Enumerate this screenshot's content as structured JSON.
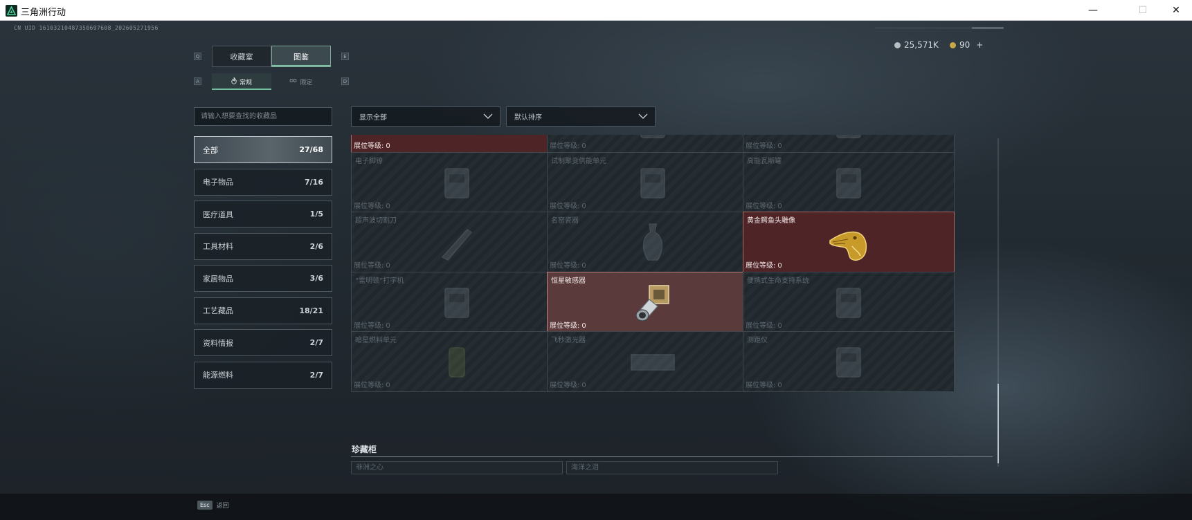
{
  "window": {
    "title": "三角洲行动",
    "minimize": "—",
    "maximize": "☐",
    "close": "✕"
  },
  "header": {
    "uid": "CN UID 16103210487350697608_202605271956",
    "currency_silver": "25,571K",
    "currency_gold": "90",
    "add_label": "+",
    "colors": {
      "silver": "#b8bec3",
      "gold": "#c9a648"
    }
  },
  "tabs": {
    "key_left": "Q",
    "key_right": "E",
    "items": [
      {
        "label": "收藏室"
      },
      {
        "label": "图鉴",
        "active": true
      }
    ]
  },
  "subtabs": {
    "key_left": "A",
    "key_right": "D",
    "items": [
      {
        "label": "常规",
        "icon": "flame-icon",
        "active": true
      },
      {
        "label": "限定",
        "icon": "infinity-icon"
      }
    ]
  },
  "search": {
    "placeholder": "请输入想要查找的收藏品",
    "value": ""
  },
  "filters": {
    "show": "显示全部",
    "sort": "默认排序"
  },
  "categories": [
    {
      "label": "全部",
      "count": "27/68",
      "active": true
    },
    {
      "label": "电子物品",
      "count": "7/16"
    },
    {
      "label": "医疗道具",
      "count": "1/5"
    },
    {
      "label": "工具材料",
      "count": "2/6"
    },
    {
      "label": "家居物品",
      "count": "3/6"
    },
    {
      "label": "工艺藏品",
      "count": "18/21"
    },
    {
      "label": "资料情报",
      "count": "2/7"
    },
    {
      "label": "能源燃料",
      "count": "2/7"
    }
  ],
  "level_label": "展位等级:",
  "items": [
    {
      "name": "",
      "level": "0",
      "owned": "red",
      "icon": "circuit-chip-icon"
    },
    {
      "name": "",
      "level": "0",
      "owned": "none",
      "icon": "device-icon"
    },
    {
      "name": "",
      "level": "0",
      "owned": "none",
      "icon": "device-icon"
    },
    {
      "name": "电子脚镣",
      "level": "0",
      "owned": "none",
      "icon": "ankle-monitor-icon"
    },
    {
      "name": "试制聚变供能单元",
      "level": "0",
      "owned": "none",
      "icon": "fusion-unit-icon"
    },
    {
      "name": "高能瓦斯罐",
      "level": "0",
      "owned": "none",
      "icon": "gas-canister-icon"
    },
    {
      "name": "超声波切割刀",
      "level": "0",
      "owned": "none",
      "icon": "ultrasonic-knife-icon"
    },
    {
      "name": "名窑瓷器",
      "level": "0",
      "owned": "none",
      "icon": "porcelain-vase-icon"
    },
    {
      "name": "黄金鳄鱼头雕像",
      "level": "0",
      "owned": "red",
      "icon": "gold-crocodile-icon"
    },
    {
      "name": "“雷明顿”打字机",
      "level": "0",
      "owned": "none",
      "icon": "typewriter-icon"
    },
    {
      "name": "恒星敏感器",
      "level": "0",
      "owned": "rose",
      "icon": "star-sensor-icon"
    },
    {
      "name": "便携式生命支持系统",
      "level": "0",
      "owned": "none",
      "icon": "life-support-icon"
    },
    {
      "name": "暗星燃料单元",
      "level": "0",
      "owned": "none",
      "icon": "fuel-cell-icon"
    },
    {
      "name": "飞秒激光器",
      "level": "0",
      "owned": "none",
      "icon": "laser-icon"
    },
    {
      "name": "测距仪",
      "level": "0",
      "owned": "none",
      "icon": "rangefinder-icon"
    }
  ],
  "cabinet": {
    "title": "珍藏柜",
    "items": [
      {
        "name": "非洲之心"
      },
      {
        "name": "海洋之泪"
      }
    ]
  },
  "footer": {
    "esc_key": "Esc",
    "esc_label": "返回"
  }
}
